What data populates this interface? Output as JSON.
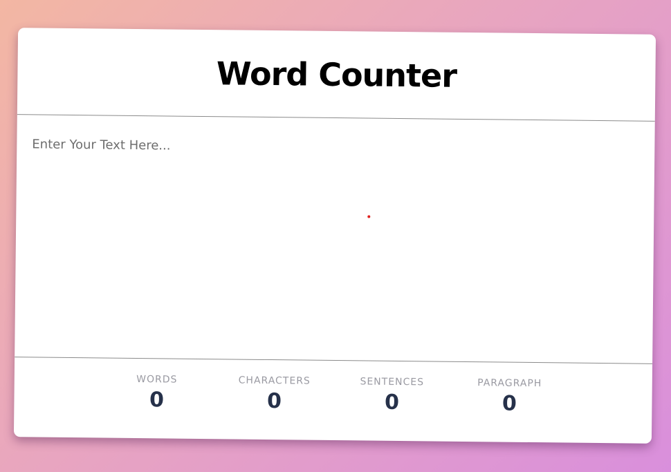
{
  "app": {
    "title": "Word Counter"
  },
  "editor": {
    "placeholder": "Enter Your Text Here...",
    "value": ""
  },
  "stats": [
    {
      "label": "WORDS",
      "value": "0"
    },
    {
      "label": "CHARACTERS",
      "value": "0"
    },
    {
      "label": "SENTENCES",
      "value": "0"
    },
    {
      "label": "PARAGRAPH",
      "value": "0"
    }
  ],
  "colors": {
    "background_start": "#f3b7a3",
    "background_end": "#d98fdc",
    "card": "#ffffff",
    "stat_value": "#26314a",
    "stat_label": "#9a9aa2",
    "cursor_dot": "#e0201e"
  }
}
